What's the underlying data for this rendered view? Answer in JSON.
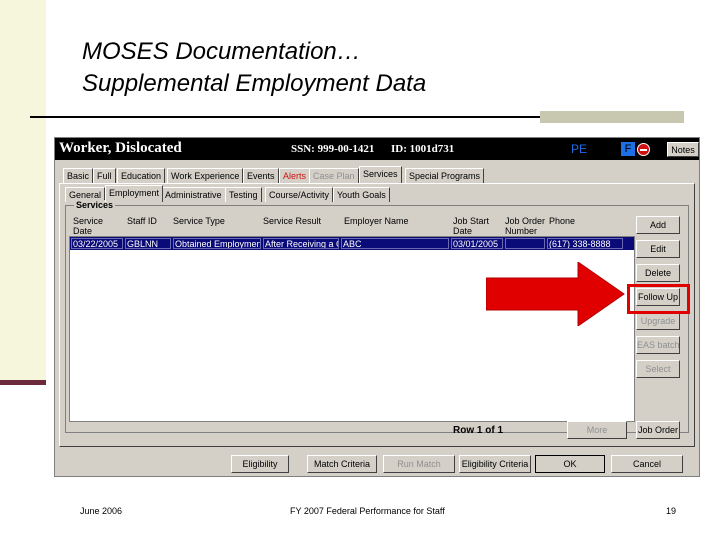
{
  "slide": {
    "title_line1": "MOSES Documentation…",
    "title_line2": "Supplemental Employment Data"
  },
  "window": {
    "title": "Worker, Dislocated",
    "ssn": "SSN:  999-00-1421",
    "id": "ID: 1001d731",
    "pe_label": "PE",
    "flag_label": "F",
    "notes_label": "Notes"
  },
  "tabs_main": [
    {
      "label": "Basic"
    },
    {
      "label": "Full"
    },
    {
      "label": "Education"
    },
    {
      "label": "Work Experience"
    },
    {
      "label": "Events"
    },
    {
      "label": "Alerts"
    },
    {
      "label": "Case Plan"
    },
    {
      "label": "Services"
    },
    {
      "label": "Special Programs"
    }
  ],
  "tabs_sub": [
    {
      "label": "General"
    },
    {
      "label": "Employment"
    },
    {
      "label": "Administrative"
    },
    {
      "label": "Testing"
    },
    {
      "label": "Course/Activity"
    },
    {
      "label": "Youth Goals"
    }
  ],
  "services": {
    "group_label": "Services",
    "columns": {
      "service_date_1": "Service",
      "service_date_2": "Date",
      "staff_id": "Staff ID",
      "service_type": "Service Type",
      "service_result": "Service Result",
      "employer_name": "Employer Name",
      "job_start_1": "Job Start",
      "job_start_2": "Date",
      "job_order_1": "Job Order",
      "job_order_2": "Number",
      "phone": "Phone"
    },
    "rows": [
      {
        "service_date": "03/22/2005",
        "staff_id": "GBLNN",
        "service_type": "Obtained Employment",
        "service_result": "After Receiving a C",
        "employer_name": "ABC",
        "job_start": "03/01/2005",
        "job_order": "",
        "phone": "(617) 338-8888"
      }
    ],
    "row_count": "Row 1 of 1"
  },
  "side_buttons": {
    "add": "Add",
    "edit": "Edit",
    "delete": "Delete",
    "follow_up": "Follow Up",
    "upgrade": "Upgrade",
    "eas_batch": "EAS batch",
    "select": "Select",
    "more": "More",
    "job_order": "Job Order"
  },
  "bottom_buttons": {
    "eligibility": "Eligibility",
    "match_criteria": "Match Criteria",
    "run_match": "Run Match",
    "eligibility_criteria": "Eligibility Criteria",
    "ok": "OK",
    "cancel": "Cancel"
  },
  "footer": {
    "date": "June 2006",
    "center": "FY 2007 Federal Performance for Staff",
    "page": "19"
  },
  "colors": {
    "highlight_red": "#e00000",
    "arrow_red": "#e00000",
    "selection_blue": "#0a0a78",
    "window_gray": "#d4d0c8"
  }
}
